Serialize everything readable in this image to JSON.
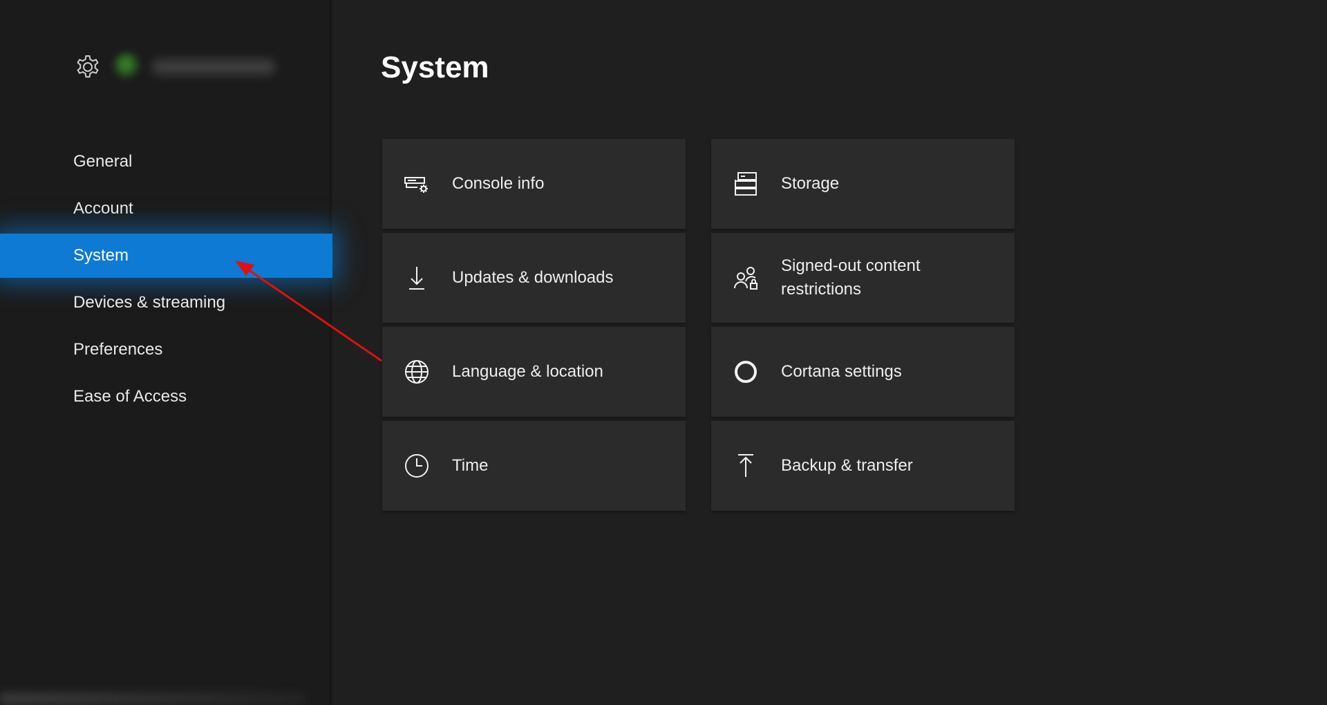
{
  "page": {
    "title": "System"
  },
  "sidebar": {
    "items": [
      {
        "label": "General",
        "active": false
      },
      {
        "label": "Account",
        "active": false
      },
      {
        "label": "System",
        "active": true
      },
      {
        "label": "Devices & streaming",
        "active": false
      },
      {
        "label": "Preferences",
        "active": false
      },
      {
        "label": "Ease of Access",
        "active": false
      }
    ]
  },
  "tiles": [
    {
      "label": "Console info",
      "icon": "console-info-icon"
    },
    {
      "label": "Storage",
      "icon": "storage-icon"
    },
    {
      "label": "Updates & downloads",
      "icon": "download-arrow-icon"
    },
    {
      "label": "Signed-out content restrictions",
      "icon": "users-lock-icon"
    },
    {
      "label": "Language & location",
      "icon": "globe-icon"
    },
    {
      "label": "Cortana settings",
      "icon": "cortana-circle-icon"
    },
    {
      "label": "Time",
      "icon": "clock-icon"
    },
    {
      "label": "Backup & transfer",
      "icon": "upload-arrow-icon"
    }
  ],
  "colors": {
    "background": "#1f1f1f",
    "sidebar": "#1b1b1b",
    "accent": "#0e7ad4",
    "tile": "#2b2b2b",
    "annotation_arrow": "#e01010"
  }
}
